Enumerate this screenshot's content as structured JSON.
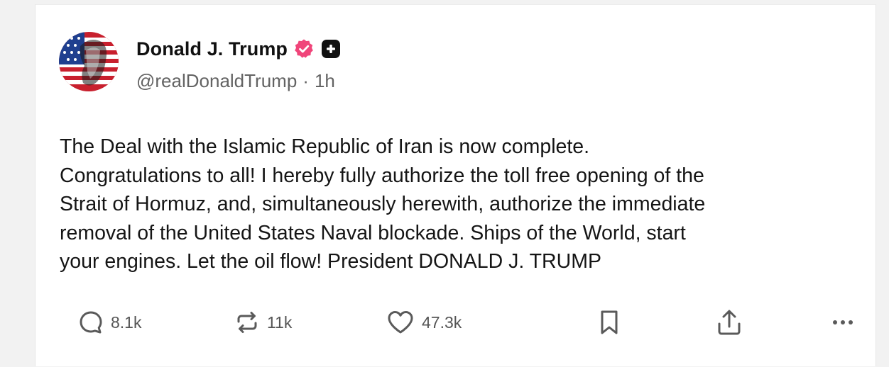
{
  "post": {
    "author": {
      "name": "Donald J. Trump",
      "handle": "@realDonaldTrump",
      "time": "1h",
      "verified_color": "#f0457a",
      "avatar_icon": "flag-portrait-avatar"
    },
    "text": "The Deal with the Islamic Republic of Iran is now complete.\nCongratulations to all! I hereby fully authorize the toll free opening of the\nStrait of Hormuz, and, simultaneously herewith, authorize the immediate\nremoval of the United States Naval blockade. Ships of the World, start\nyour engines. Let the oil flow! President DONALD J. TRUMP",
    "actions": {
      "replies": "8.1k",
      "reposts": "11k",
      "likes": "47.3k"
    }
  },
  "icons": {
    "reply": "reply-bubble-icon",
    "repost": "repost-arrows-icon",
    "like": "heart-icon",
    "bookmark": "bookmark-icon",
    "share": "share-upload-icon",
    "more": "more-dots-icon"
  }
}
